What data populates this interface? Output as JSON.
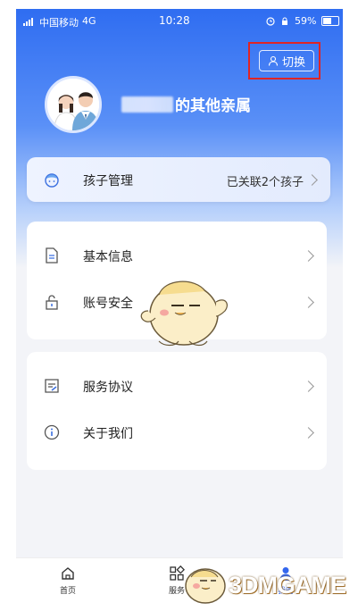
{
  "status_bar": {
    "carrier": "中国移动",
    "network": "4G",
    "time": "10:28",
    "battery": "59%"
  },
  "header": {
    "switch_label": "切换",
    "profile_name_suffix": "的其他亲属"
  },
  "child_row": {
    "label": "孩子管理",
    "value": "已关联2个孩子"
  },
  "menu_group_1": [
    {
      "label": "基本信息"
    },
    {
      "label": "账号安全"
    }
  ],
  "menu_group_2": [
    {
      "label": "服务协议"
    },
    {
      "label": "关于我们"
    }
  ],
  "tabbar": [
    {
      "label": "首页"
    },
    {
      "label": "服务"
    },
    {
      "label": "我的"
    }
  ],
  "watermark": {
    "text": "3DMGAME"
  },
  "colors": {
    "primary": "#2f6df1",
    "highlight": "#e02424",
    "tab_active": "#3366ee"
  }
}
